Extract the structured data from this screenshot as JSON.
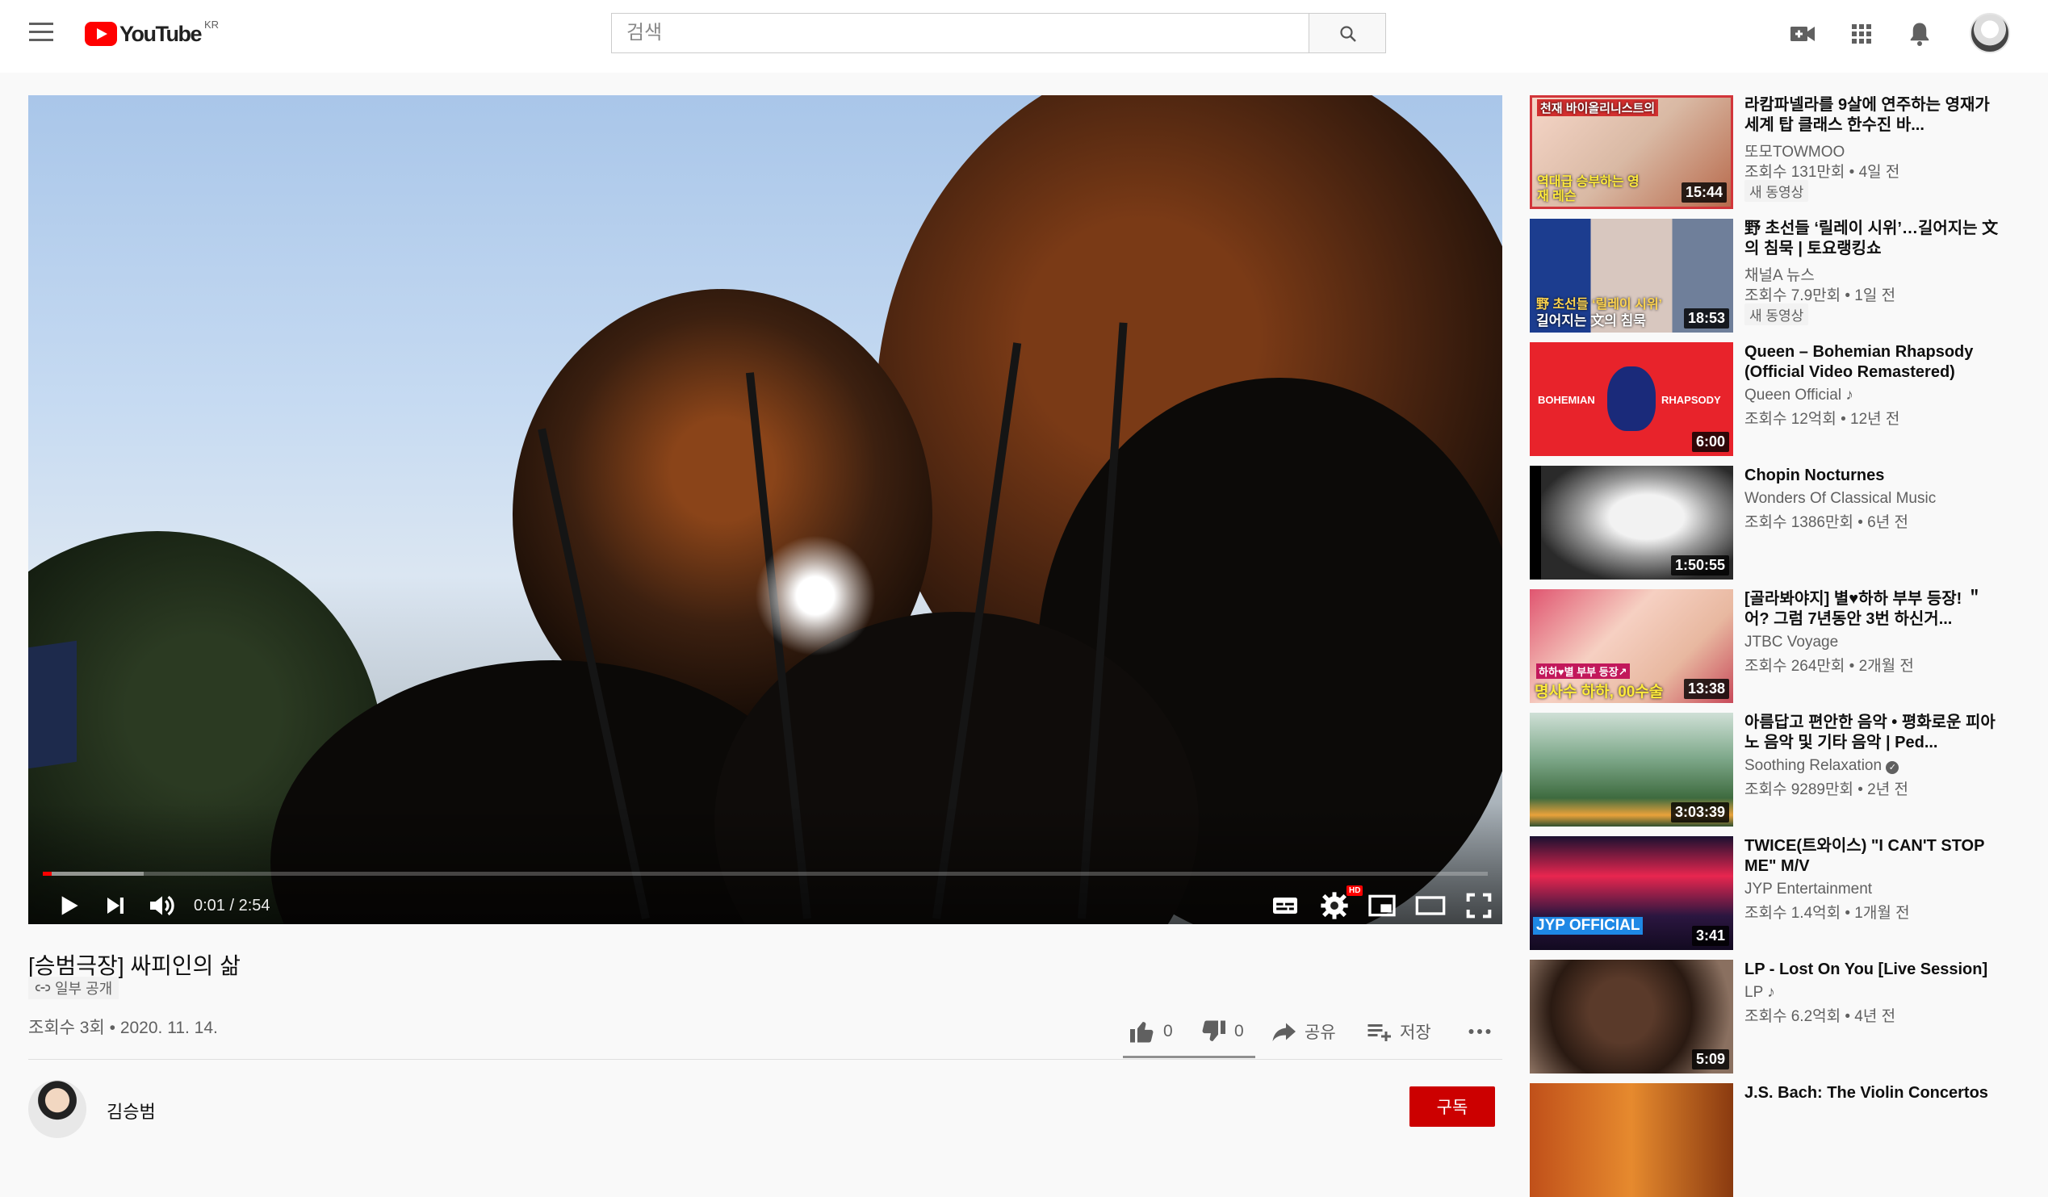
{
  "header": {
    "logo_text": "YouTube",
    "logo_region": "KR",
    "search_placeholder": "검색",
    "icons": [
      "menu-icon",
      "create-video-icon",
      "apps-icon",
      "notifications-icon",
      "search-icon"
    ]
  },
  "player": {
    "time": "0:01 / 2:54",
    "progress_played": 0.006,
    "progress_loaded": 0.07,
    "hd_badge": "HD"
  },
  "video": {
    "title": "[승범극장] 싸피인의 삶",
    "privacy": "일부 공개",
    "views_date": "조회수 3회 • 2020. 11. 14.",
    "likes": "0",
    "dislikes": "0",
    "share_label": "공유",
    "save_label": "저장"
  },
  "channel": {
    "name": "김승범",
    "subscribe_label": "구독"
  },
  "recommendations": [
    {
      "title": "라캄파넬라를 9살에 연주하는 영재가 세계 탑 클래스 한수진 바...",
      "channel": "또모TOWMOO",
      "meta": "조회수 131만회 • 4일 전",
      "badge": "새 동영상",
      "duration": "15:44",
      "thumb_text_1": "천재 바이올리니스트의",
      "thumb_text_2": "역대급 승부하는 영재 레슨"
    },
    {
      "title": "野 초선들 ‘릴레이 시위’…길어지는 文의 침묵 | 토요랭킹쇼",
      "channel": "채널A 뉴스",
      "meta": "조회수 7.9만회 • 1일 전",
      "badge": "새 동영상",
      "duration": "18:53",
      "thumb_text_1": "野 초선들 ‘릴레이 시위’",
      "thumb_text_2": "길어지는 文의 침묵"
    },
    {
      "title": "Queen – Bohemian Rhapsody (Official Video Remastered)",
      "channel": "Queen Official",
      "meta": "조회수 12억회 • 12년 전",
      "badge": "",
      "duration": "6:00",
      "thumb_text_1": "BOHEMIAN",
      "thumb_text_2": "RHAPSODY"
    },
    {
      "title": "Chopin Nocturnes",
      "channel": "Wonders Of Classical Music",
      "meta": "조회수 1386만회 • 6년 전",
      "badge": "",
      "duration": "1:50:55"
    },
    {
      "title": "[골라봐야지] 별♥하하 부부 등장! ＂어? 그럼 7년동안 3번 하신거...",
      "channel": "JTBC Voyage",
      "meta": "조회수 264만회 • 2개월 전",
      "badge": "",
      "duration": "13:38",
      "thumb_text_1": "하하♥별 부부 등장↗",
      "thumb_text_2": "명사수 하하, 00수술"
    },
    {
      "title": "아름답고 편안한 음악 • 평화로운 피아노 음악 및 기타 음악 | Ped...",
      "channel": "Soothing Relaxation",
      "meta": "조회수 9289만회 • 2년 전",
      "badge": "",
      "duration": "3:03:39"
    },
    {
      "title": "TWICE(트와이스) \"I CAN'T STOP ME\" M/V",
      "channel": "JYP Entertainment",
      "meta": "조회수 1.4억회 • 1개월 전",
      "badge": "",
      "duration": "3:41",
      "thumb_text_1": "JYP OFFICIAL"
    },
    {
      "title": "LP - Lost On You [Live Session]",
      "channel": "LP",
      "meta": "조회수 6.2억회 • 4년 전",
      "badge": "",
      "duration": "5:09"
    },
    {
      "title": "J.S. Bach: The Violin Concertos",
      "channel": "",
      "meta": "",
      "badge": "",
      "duration": ""
    }
  ]
}
